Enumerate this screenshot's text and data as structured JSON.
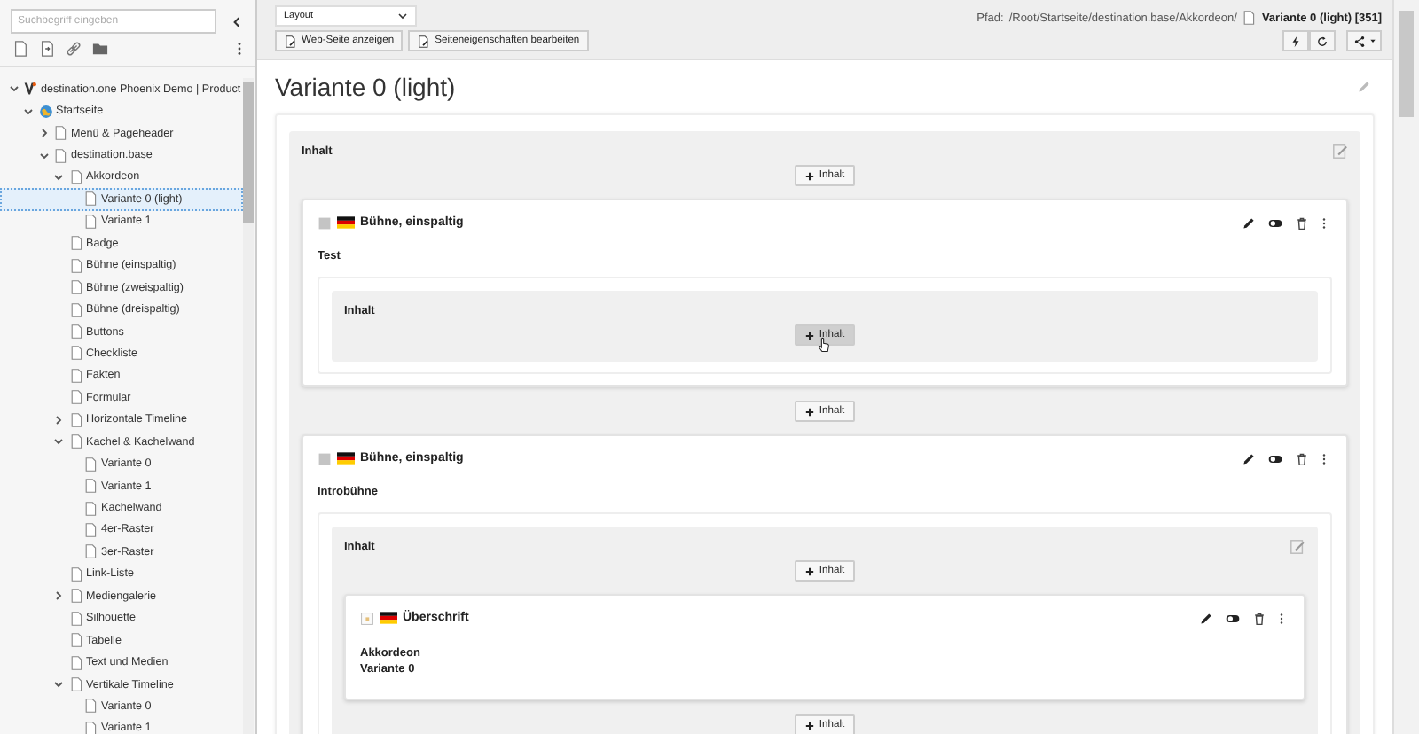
{
  "sidebar": {
    "search": {
      "placeholder": "Suchbegriff eingeben"
    },
    "tree": [
      {
        "label": "destination.one Phoenix Demo | Product",
        "kind": "site",
        "has_children": true,
        "expanded": true,
        "selected": false,
        "children": [
          {
            "label": "Startseite",
            "kind": "home",
            "has_children": true,
            "expanded": true,
            "selected": false,
            "children": [
              {
                "label": "Menü & Pageheader",
                "kind": "page",
                "has_children": true,
                "expanded": false,
                "selected": false
              },
              {
                "label": "destination.base",
                "kind": "page",
                "has_children": true,
                "expanded": true,
                "selected": false,
                "children": [
                  {
                    "label": "Akkordeon",
                    "kind": "page",
                    "has_children": true,
                    "expanded": true,
                    "selected": false,
                    "children": [
                      {
                        "label": "Variante 0 (light)",
                        "kind": "page",
                        "has_children": false,
                        "expanded": false,
                        "selected": true
                      },
                      {
                        "label": "Variante 1",
                        "kind": "page",
                        "has_children": false,
                        "expanded": false,
                        "selected": false
                      }
                    ]
                  },
                  {
                    "label": "Badge",
                    "kind": "page",
                    "has_children": false,
                    "expanded": false,
                    "selected": false
                  },
                  {
                    "label": "Bühne (einspaltig)",
                    "kind": "page",
                    "has_children": false,
                    "expanded": false,
                    "selected": false
                  },
                  {
                    "label": "Bühne (zweispaltig)",
                    "kind": "page",
                    "has_children": false,
                    "expanded": false,
                    "selected": false
                  },
                  {
                    "label": "Bühne (dreispaltig)",
                    "kind": "page",
                    "has_children": false,
                    "expanded": false,
                    "selected": false
                  },
                  {
                    "label": "Buttons",
                    "kind": "page",
                    "has_children": false,
                    "expanded": false,
                    "selected": false
                  },
                  {
                    "label": "Checkliste",
                    "kind": "page",
                    "has_children": false,
                    "expanded": false,
                    "selected": false
                  },
                  {
                    "label": "Fakten",
                    "kind": "page",
                    "has_children": false,
                    "expanded": false,
                    "selected": false
                  },
                  {
                    "label": "Formular",
                    "kind": "page",
                    "has_children": false,
                    "expanded": false,
                    "selected": false
                  },
                  {
                    "label": "Horizontale Timeline",
                    "kind": "page",
                    "has_children": true,
                    "expanded": false,
                    "selected": false
                  },
                  {
                    "label": "Kachel & Kachelwand",
                    "kind": "page",
                    "has_children": true,
                    "expanded": true,
                    "selected": false,
                    "children": [
                      {
                        "label": "Variante 0",
                        "kind": "page",
                        "has_children": false,
                        "expanded": false,
                        "selected": false
                      },
                      {
                        "label": "Variante 1",
                        "kind": "page",
                        "has_children": false,
                        "expanded": false,
                        "selected": false
                      },
                      {
                        "label": "Kachelwand",
                        "kind": "page",
                        "has_children": false,
                        "expanded": false,
                        "selected": false
                      },
                      {
                        "label": "4er-Raster",
                        "kind": "page",
                        "has_children": false,
                        "expanded": false,
                        "selected": false
                      },
                      {
                        "label": "3er-Raster",
                        "kind": "page",
                        "has_children": false,
                        "expanded": false,
                        "selected": false
                      }
                    ]
                  },
                  {
                    "label": "Link-Liste",
                    "kind": "page",
                    "has_children": false,
                    "expanded": false,
                    "selected": false
                  },
                  {
                    "label": "Mediengalerie",
                    "kind": "page",
                    "has_children": true,
                    "expanded": false,
                    "selected": false
                  },
                  {
                    "label": "Silhouette",
                    "kind": "page",
                    "has_children": false,
                    "expanded": false,
                    "selected": false
                  },
                  {
                    "label": "Tabelle",
                    "kind": "page",
                    "has_children": false,
                    "expanded": false,
                    "selected": false
                  },
                  {
                    "label": "Text und Medien",
                    "kind": "page",
                    "has_children": false,
                    "expanded": false,
                    "selected": false
                  },
                  {
                    "label": "Vertikale Timeline",
                    "kind": "page",
                    "has_children": true,
                    "expanded": true,
                    "selected": false,
                    "children": [
                      {
                        "label": "Variante 0",
                        "kind": "page",
                        "has_children": false,
                        "expanded": false,
                        "selected": false
                      },
                      {
                        "label": "Variante 1",
                        "kind": "page",
                        "has_children": false,
                        "expanded": false,
                        "selected": false
                      }
                    ]
                  }
                ]
              }
            ]
          }
        ]
      }
    ]
  },
  "toolbar": {
    "view_select": {
      "value": "Layout"
    },
    "buttons": [
      "Web-Seite anzeigen",
      "Seiteneigenschaften bearbeiten"
    ],
    "path": {
      "label": "Pfad:",
      "value": "/Root/Startseite/destination.base/Akkordeon/",
      "page": "Variante 0 (light) [351]"
    }
  },
  "page": {
    "title": "Variante 0 (light)",
    "column": {
      "title": "Inhalt",
      "editable": true,
      "items": [
        {
          "kind": "add",
          "label": "Inhalt",
          "hovered": false
        },
        {
          "kind": "stage",
          "header": "Bühne, einspaltig",
          "subheader": "Test",
          "columns": [
            {
              "title": "Inhalt",
              "editable": false,
              "items": [
                {
                  "kind": "add",
                  "label": "Inhalt",
                  "hovered": true
                }
              ]
            }
          ]
        },
        {
          "kind": "add",
          "label": "Inhalt",
          "hovered": false
        },
        {
          "kind": "stage",
          "header": "Bühne, einspaltig",
          "subheader": "Introbühne",
          "columns": [
            {
              "title": "Inhalt",
              "editable": true,
              "items": [
                {
                  "kind": "add",
                  "label": "Inhalt",
                  "hovered": false
                },
                {
                  "kind": "heading",
                  "header": "Überschrift",
                  "lines": [
                    "Akkordeon",
                    "Variante 0"
                  ]
                },
                {
                  "kind": "add",
                  "label": "Inhalt",
                  "hovered": false
                }
              ]
            }
          ]
        }
      ]
    }
  }
}
